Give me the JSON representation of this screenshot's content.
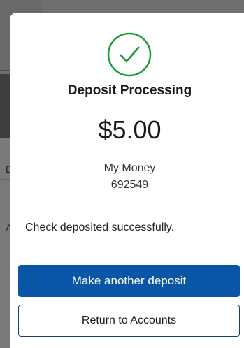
{
  "background": {
    "letters": [
      "D",
      "A"
    ]
  },
  "dialog": {
    "icon": "check-circle-icon",
    "accent_color": "#1a9a3c",
    "title": "Deposit Processing",
    "amount": "$5.00",
    "account_name": "My Money",
    "account_number": "692549",
    "message": "Check deposited successfully.",
    "primary_button": "Make another deposit",
    "primary_color": "#0a56a6",
    "secondary_button": "Return to Accounts"
  }
}
